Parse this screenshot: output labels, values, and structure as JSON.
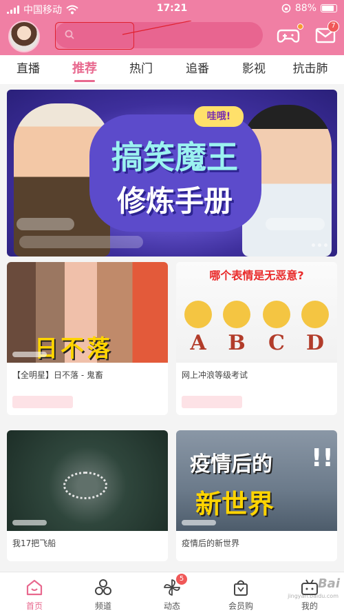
{
  "status_bar": {
    "carrier": "中国移动",
    "time": "17:21",
    "battery": "88%"
  },
  "header": {
    "mail_badge": "7",
    "game_icon": "gamepad-icon",
    "mail_icon": "mail-icon"
  },
  "tabs": [
    {
      "label": "直播"
    },
    {
      "label": "推荐",
      "active": true
    },
    {
      "label": "热门"
    },
    {
      "label": "追番"
    },
    {
      "label": "影视"
    },
    {
      "label": "抗击肺"
    }
  ],
  "banner": {
    "title_line1": "搞笑魔王",
    "title_line2": "修炼手册",
    "pill": "哇哦!"
  },
  "cards": [
    {
      "title": "【全明星】日不落 - 鬼畜",
      "thumb_text": "日不落"
    },
    {
      "title": "网上冲浪等级考试",
      "thumb_question": "哪个表情是无恶意?",
      "letters": [
        "A",
        "B",
        "C",
        "D"
      ]
    },
    {
      "title": "我17把飞船"
    },
    {
      "title": "疫情后的新世界",
      "thumb_line1": "疫情后的",
      "thumb_line2": "新世界"
    }
  ],
  "bottom_nav": [
    {
      "label": "首页",
      "icon": "home-icon",
      "active": true
    },
    {
      "label": "频道",
      "icon": "channels-icon"
    },
    {
      "label": "动态",
      "icon": "pinwheel-icon",
      "badge": "5"
    },
    {
      "label": "会员购",
      "icon": "shopping-bag-icon"
    },
    {
      "label": "我的",
      "icon": "tv-icon"
    }
  ],
  "watermark": {
    "text": "Bai",
    "sub": "jingyan.baidu.com"
  },
  "colors": {
    "brand_pink": "#f07fa4",
    "accent": "#e8688e",
    "badge_red": "#f05858"
  }
}
